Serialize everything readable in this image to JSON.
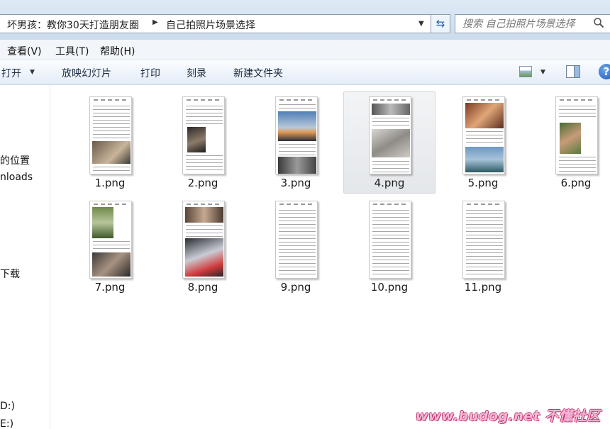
{
  "address_bar": {
    "breadcrumbs": [
      "坏男孩：教你30天打造朋友圈",
      "自己拍照片场景选择"
    ],
    "separator_icon": "triangle-right-icon",
    "dropdown_icon": "triangle-down-icon"
  },
  "refresh": {
    "icon": "refresh-icon",
    "glyph": "⇆"
  },
  "search": {
    "placeholder": "搜索 自己拍照片场景选择",
    "icon": "magnifier-icon"
  },
  "menu": {
    "items": [
      "查看(V)",
      "工具(T)",
      "帮助(H)"
    ]
  },
  "toolbar": {
    "items": [
      "打开",
      "放映幻灯片",
      "打印",
      "刻录",
      "新建文件夹"
    ],
    "help_glyph": "?"
  },
  "nav": {
    "items": [
      "的位置",
      "nloads",
      "下载",
      "D:)",
      "E:)"
    ]
  },
  "files": [
    {
      "name": "1.png"
    },
    {
      "name": "2.png"
    },
    {
      "name": "3.png"
    },
    {
      "name": "4.png"
    },
    {
      "name": "5.png"
    },
    {
      "name": "6.png"
    },
    {
      "name": "7.png"
    },
    {
      "name": "8.png"
    },
    {
      "name": "9.png"
    },
    {
      "name": "10.png"
    },
    {
      "name": "11.png"
    }
  ],
  "selected_file": "4.png",
  "watermark": "www.budog.net 不懂社区"
}
